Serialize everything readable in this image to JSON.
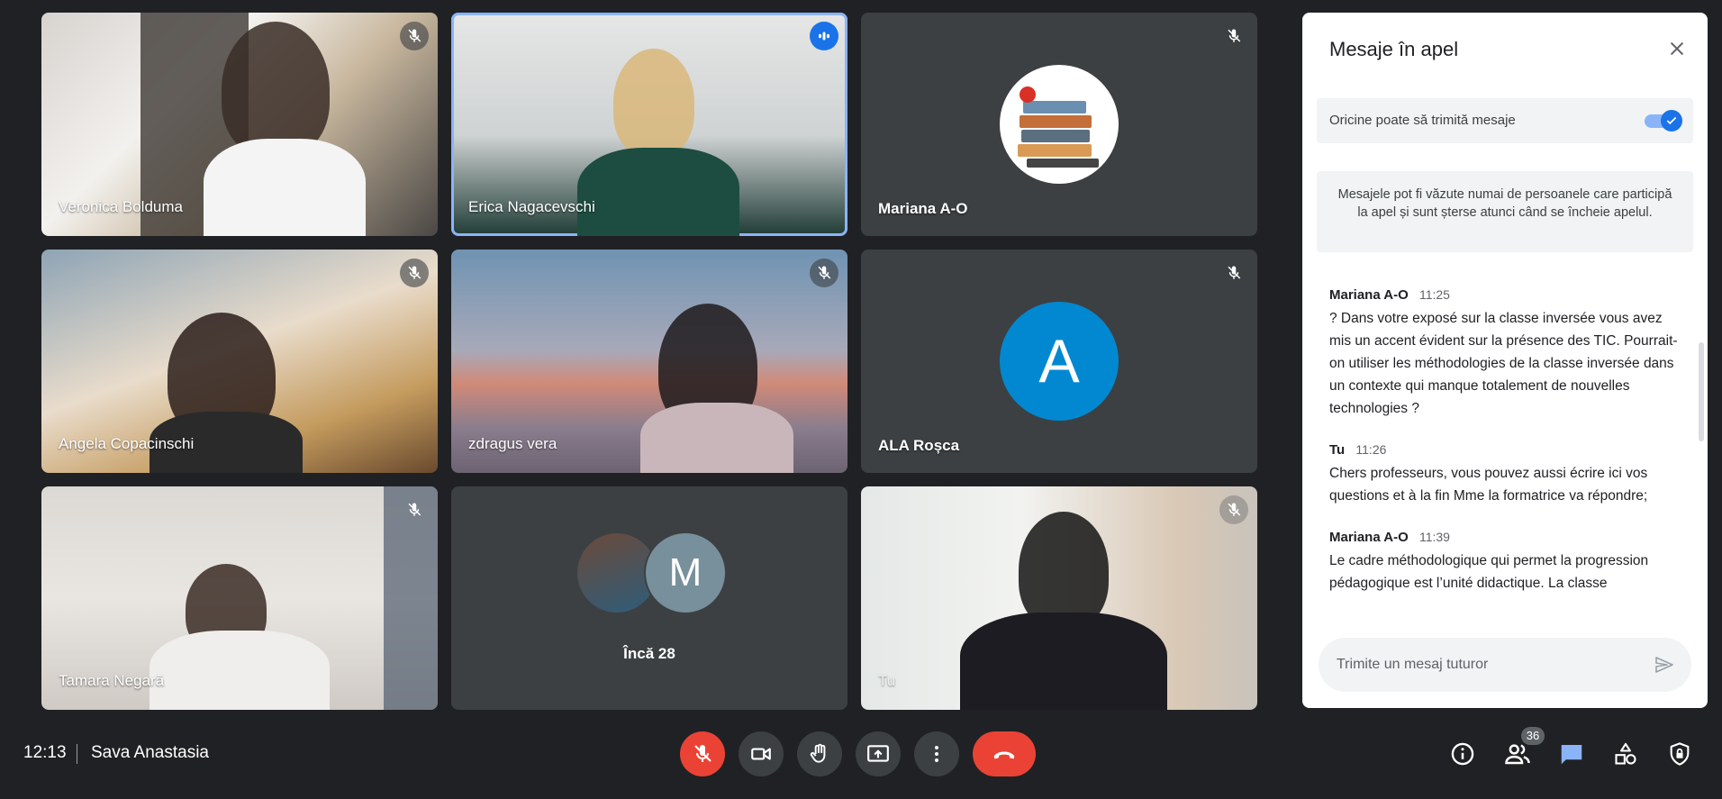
{
  "participants": [
    {
      "name": "Veronica Bolduma",
      "state": "muted"
    },
    {
      "name": "Erica Nagacevschi",
      "state": "speaking"
    },
    {
      "name": "Mariana A-O",
      "state": "muted"
    },
    {
      "name": "Angela Copacinschi",
      "state": "muted"
    },
    {
      "name": "zdragus vera",
      "state": "muted"
    },
    {
      "name": "ALA Roșca",
      "state": "muted",
      "avatar_letter": "A"
    },
    {
      "name": "Tamara Negară",
      "state": "muted"
    },
    {
      "name": "Tu",
      "state": "muted"
    }
  ],
  "overflow": {
    "label": "Încă 28",
    "avatar_letter": "M"
  },
  "chat": {
    "title": "Mesaje în apel",
    "allow_toggle_label": "Oricine poate să trimită mesaje",
    "allow_toggle_on": true,
    "info": "Mesajele pot fi văzute numai de persoanele care participă la apel și sunt șterse atunci când se încheie apelul.",
    "messages": [
      {
        "sender": "Mariana A-O",
        "time": "11:25",
        "text": "? Dans votre exposé sur la classe inversée vous avez mis un accent évident sur la présence des TIC. Pourrait-on utiliser les méthodologies de la classe inversée dans un contexte qui manque totalement de nouvelles technologies ?"
      },
      {
        "sender": "Tu",
        "time": "11:26",
        "text": "Chers professeurs, vous pouvez aussi écrire ici vos questions et à la fin Mme la formatrice va répondre;"
      },
      {
        "sender": "Mariana A-O",
        "time": "11:39",
        "text": "Le cadre méthodologique qui permet la progression pédagogique est l’unité didactique. La classe"
      }
    ],
    "compose_placeholder": "Trimite un mesaj tuturor"
  },
  "bottom_bar": {
    "time": "12:13",
    "meeting_name": "Sava Anastasia",
    "participants_count": "36"
  },
  "colors": {
    "background": "#202124",
    "tile": "#3c4043",
    "accent": "#1a73e8",
    "danger": "#ea4335",
    "avatar_a": "#0288d1",
    "avatar_m": "#78909c"
  },
  "icons": {
    "mute": "mic-off-icon",
    "speaking": "audio-level-icon",
    "close": "close-icon",
    "send": "send-icon",
    "camera": "videocam-icon",
    "hand": "raise-hand-icon",
    "present": "present-screen-icon",
    "more": "more-vert-icon",
    "end_call": "call-end-icon",
    "info": "info-icon",
    "people": "people-icon",
    "chat": "chat-icon",
    "activities": "activities-icon",
    "host": "host-controls-icon"
  }
}
